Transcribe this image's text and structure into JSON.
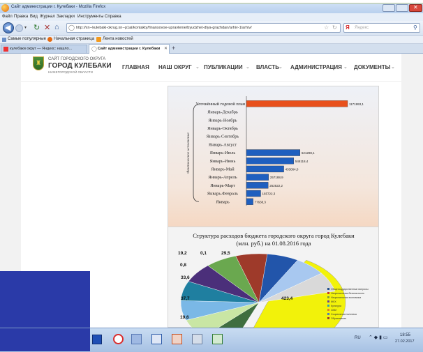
{
  "window": {
    "title": "Сайт администрации г. Кулебаки - Mozilla Firefox"
  },
  "menubar": [
    "Файл",
    "Правка",
    "Вид",
    "Журнал",
    "Закладки",
    "Инструменты",
    "Справка"
  ],
  "navbar": {
    "url": "http://xn--kulebaki-okrug.xn--p1ai/kontakty/finansovoe-upravlenie/byudzhet-dlya-grazhdan/arhiv-1/arhiv/",
    "search_placeholder": "Яндекс"
  },
  "bookmarks": [
    "Самые популярные",
    "Начальная страница",
    "Лента новостей"
  ],
  "tabs": [
    {
      "label": "кулебаки округ — Яндекс: нашло..."
    },
    {
      "label": "Сайт администрации г. Кулебаки"
    }
  ],
  "site": {
    "logo_line1": "САЙТ ГОРОДСКОГО ОКРУГА",
    "logo_line2": "ГОРОД КУЛЕБАКИ",
    "logo_line3": "НИЖЕГОРОДСКОЙ ОБЛАСТИ",
    "nav": [
      "ГЛАВНАЯ",
      "НАШ ОКРУГ",
      "ПУБЛИКАЦИИ",
      "ВЛАСТЬ",
      "АДМИНИСТРАЦИЯ",
      "ДОКУМЕНТЫ"
    ]
  },
  "chart_data": [
    {
      "type": "bar",
      "orientation": "horizontal",
      "categories": [
        "Уточнённый годовой план",
        "Январь-Декабрь",
        "Январь-Ноябрь",
        "Январь-Октябрь",
        "Январь-Сентябрь",
        "Январь-Август",
        "Январь-Июль",
        "Январь-Июнь",
        "Январь-Май",
        "Январь-Апрель",
        "Январь-Март",
        "Январь-Февраль",
        "Январь"
      ],
      "values": [
        1171993.1,
        null,
        null,
        null,
        null,
        null,
        621298.1,
        548118.4,
        433064.0,
        257188.9,
        252522.2,
        165722.3,
        77638.3
      ],
      "value_labels": [
        "1171993,1",
        "",
        "",
        "",
        "",
        "",
        "621298,1",
        "548118,4",
        "433064,0",
        "257188,9",
        "252522,2",
        "165722,3",
        "77638,3"
      ],
      "ylabel": "Фактическое исполнение",
      "colors": {
        "plan": "#e8501c",
        "actual": "#1f5fbf"
      }
    },
    {
      "type": "pie",
      "title": "Структура расходов бюджета городского округа город Кулебаки (млн. руб.) на 01.08.2016 года",
      "visible_labels": [
        "19,2",
        "0,1",
        "29,5",
        "0,8",
        "33,6",
        "37,7",
        "19,6",
        "423,4"
      ],
      "legend": [
        "Общегосударственные вопросы",
        "Национальная безопасность",
        "Национальная экономика",
        "ЖКХ",
        "Культура",
        "СМИ",
        "Социальная политика",
        "Образование"
      ],
      "large_slice_value": 423.4,
      "large_slice_color": "#f2f20a"
    }
  ],
  "taskbar": {
    "lang": "RU",
    "time": "18:55",
    "date": "27.02.2017"
  }
}
